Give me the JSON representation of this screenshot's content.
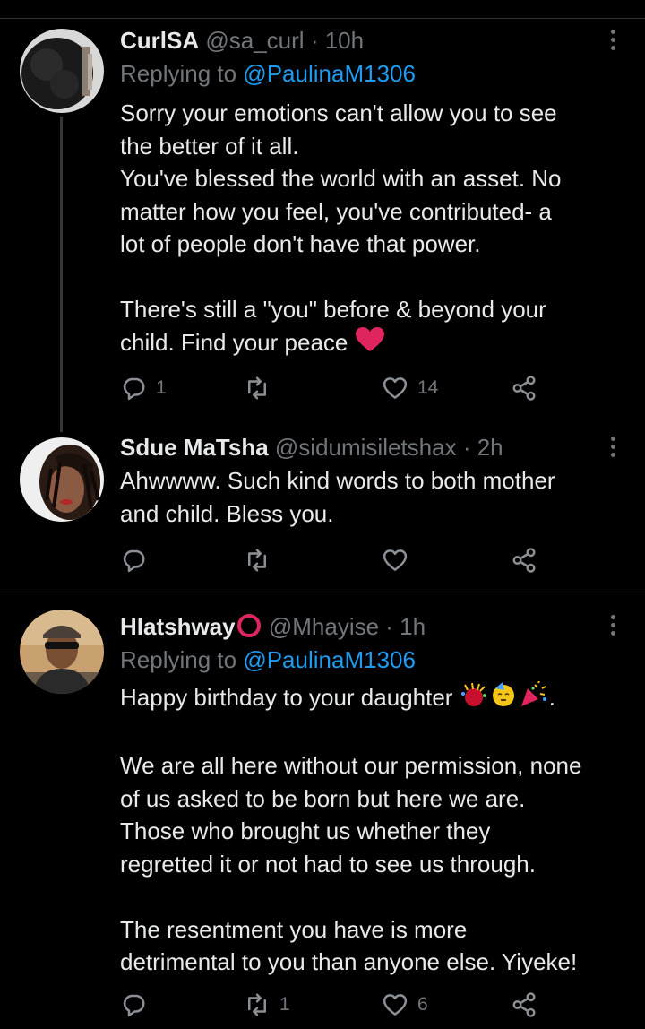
{
  "tweets": [
    {
      "name": "CurlSA",
      "handle": "@sa_curl",
      "time": "· 10h",
      "replying_prefix": "Replying to",
      "replying_to": "@PaulinaM1306",
      "lines": [
        "Sorry your emotions can't allow you to see",
        "the better of it all.",
        "You've blessed the world with an asset. No",
        "matter how you feel, you've contributed- a",
        "lot of people don't have that power.",
        "",
        "There's still a \"you\" before & beyond your",
        "child. Find your peace"
      ],
      "reply_count": "1",
      "retweet_count": "",
      "like_count": "14"
    },
    {
      "name": "Sdue MaTsha",
      "handle": "@sidumisiletshax",
      "time": "· 2h",
      "lines": [
        "Ahwwww. Such kind words to both mother",
        "and child. Bless you."
      ],
      "reply_count": "",
      "retweet_count": "",
      "like_count": ""
    },
    {
      "name": "Hlatshway",
      "handle": "@Mhayise",
      "time": "· 1h",
      "replying_prefix": "Replying to",
      "replying_to": "@PaulinaM1306",
      "lines": [
        "Happy birthday to your daughter",
        "",
        "We are all here without our permission, none",
        "of us asked to be born but here we are.",
        "Those who brought us whether they",
        "regretted it or not had to see us through.",
        "",
        "The resentment you have is more",
        "detrimental to you than anyone else. Yiyeke!"
      ],
      "line0_suffix": ".",
      "reply_count": "",
      "retweet_count": "1",
      "like_count": "6"
    }
  ],
  "icons": {
    "reply": "reply-icon",
    "retweet": "retweet-icon",
    "like": "heart-icon",
    "share": "share-icon",
    "more": "more-dots-icon",
    "heart_emoji": "red-heart-emoji",
    "ring": "red-ring-emoji"
  },
  "colors": {
    "background": "#000000",
    "text": "#e7e9ea",
    "secondary": "#71767b",
    "link": "#1d9bf0",
    "divider": "#2f3336",
    "heart": "#e0245e"
  }
}
